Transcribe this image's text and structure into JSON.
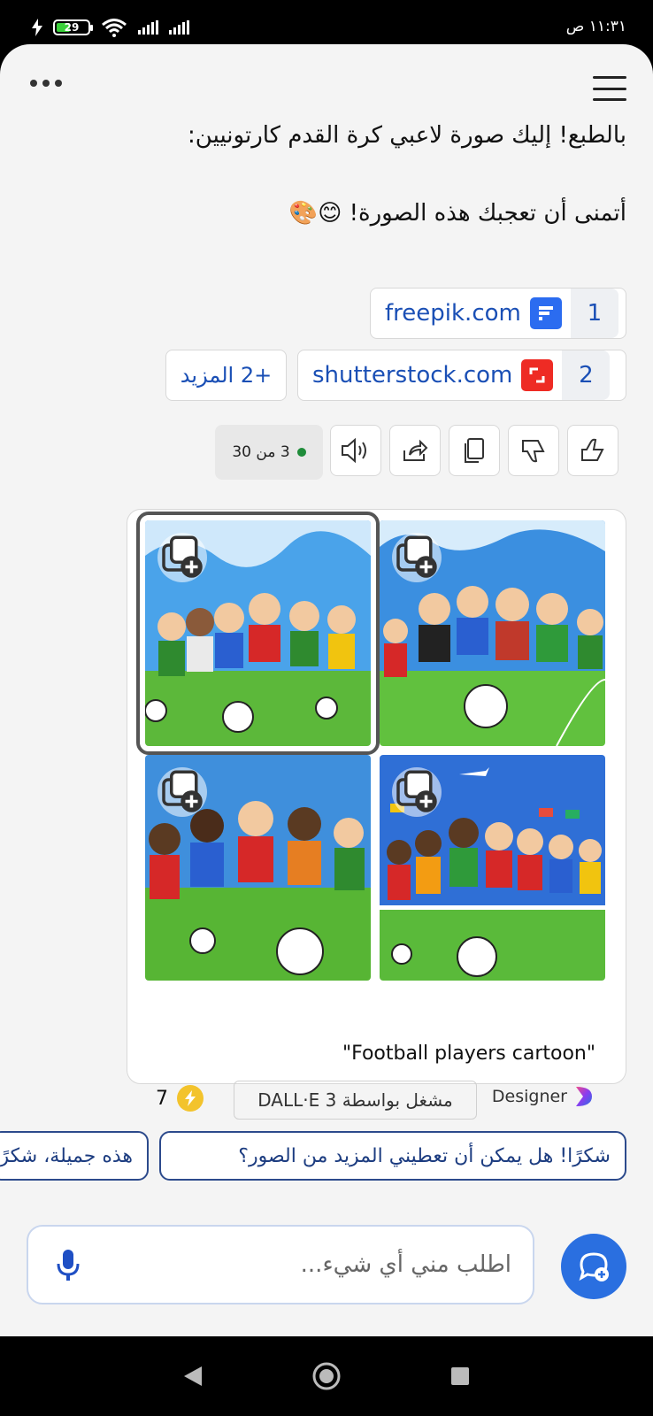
{
  "status_bar": {
    "time": "١١:٣١ ص",
    "battery": "29"
  },
  "messages": [
    "بالطبع! إليك صورة لاعبي كرة القدم كارتونيين:",
    "أتمنى أن تعجبك هذه الصورة! 😊🎨"
  ],
  "sources": [
    {
      "num": "1",
      "domain": "freepik.com"
    },
    {
      "num": "2",
      "domain": "shutterstock.com"
    }
  ],
  "more_label": "+2 المزيد",
  "counter": "3 من 30",
  "image_card": {
    "caption": "\"Football players cartoon\"",
    "designer_label": "Designer",
    "powered_by": "مشغل بواسطة DALL·E 3",
    "boosts": "7"
  },
  "suggestions": [
    "شكرًا! هل يمكن أن تعطيني المزيد من الصور؟",
    "هذه جميلة، شكرًا!"
  ],
  "input": {
    "placeholder": "اطلب مني أي شيء..."
  },
  "colors": {
    "accent": "#2a6fe0",
    "link": "#1a4fb5",
    "status_green": "#1f8c3a"
  }
}
